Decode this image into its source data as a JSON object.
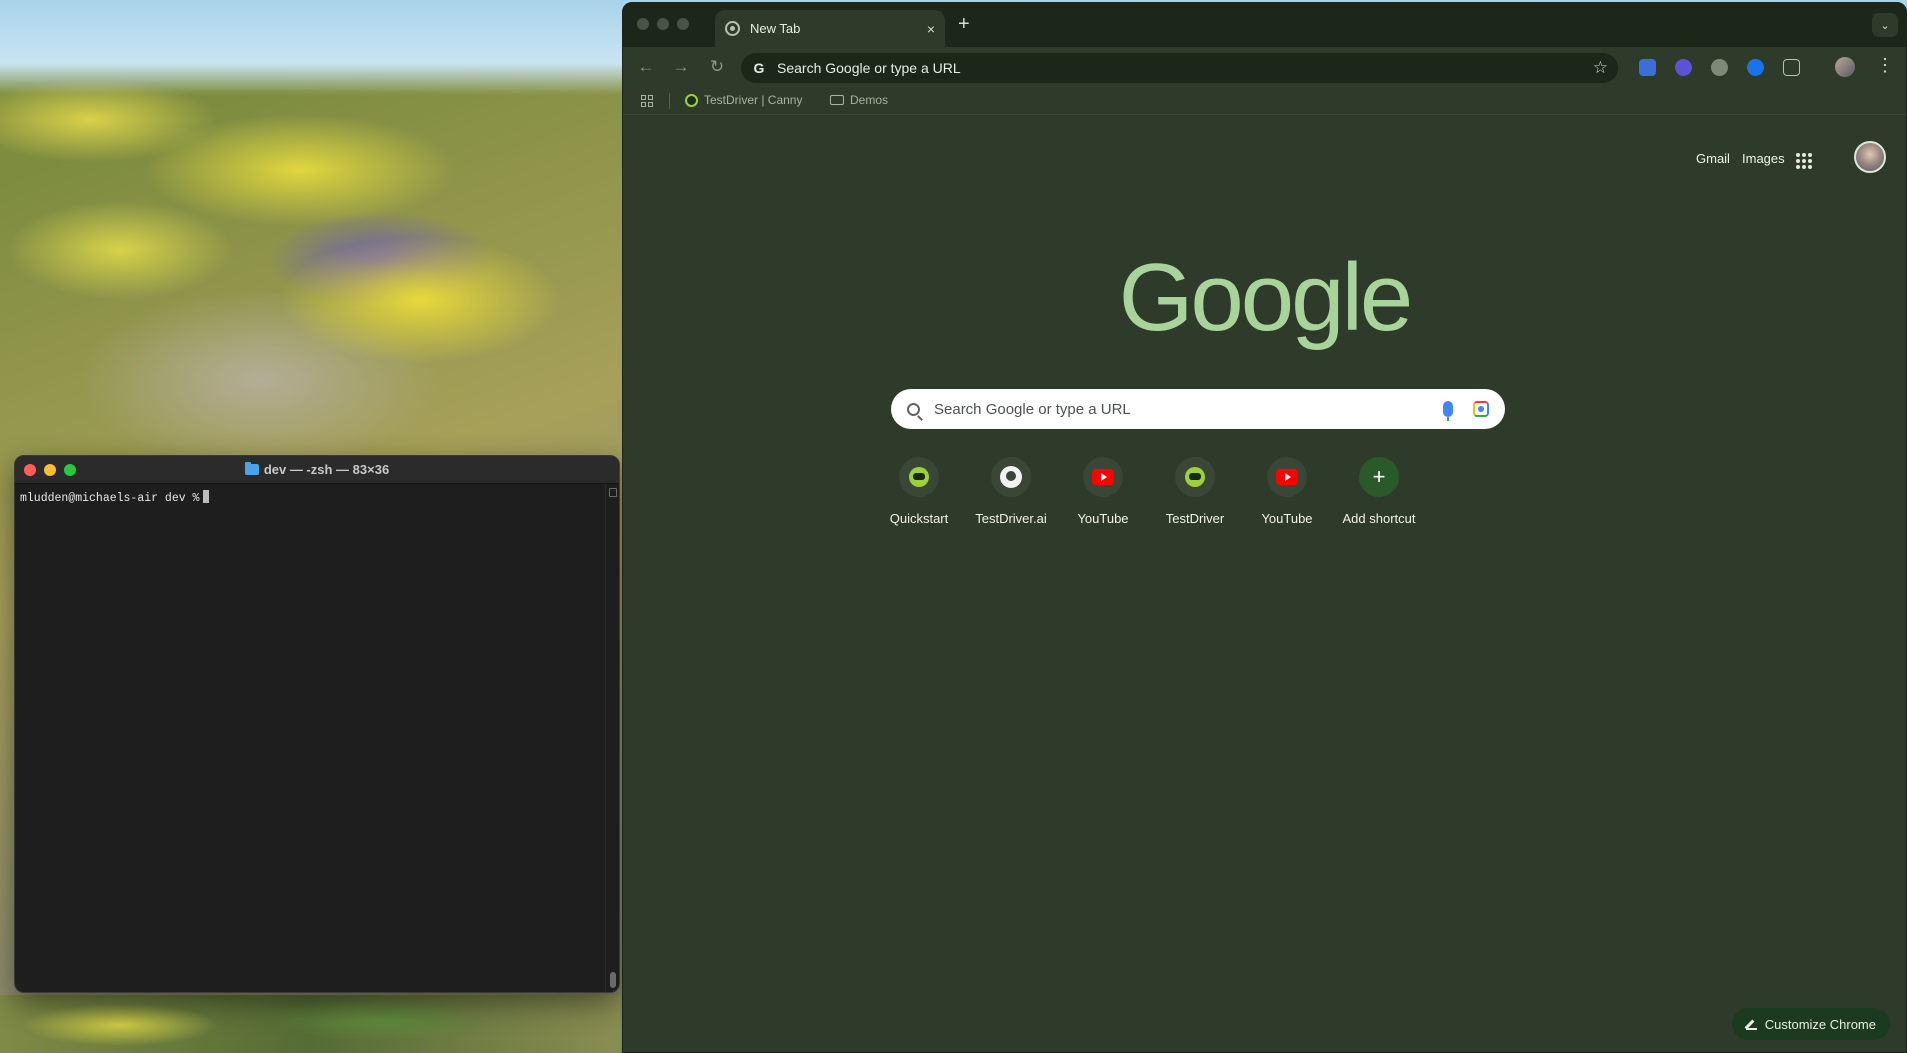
{
  "terminal": {
    "title": "dev — -zsh — 83×36",
    "prompt": "mludden@michaels-air dev %"
  },
  "chrome": {
    "tab": {
      "title": "New Tab",
      "close": "×"
    },
    "new_tab": "+",
    "tab_search": "⌄",
    "nav": {
      "back": "←",
      "forward": "→",
      "reload": "↻"
    },
    "omnibox": {
      "badge": "G",
      "text": "Search Google or type a URL",
      "star": "☆"
    },
    "kebab": "⋮",
    "bookmarks": [
      {
        "label": "TestDriver | Canny"
      },
      {
        "label": "Demos"
      }
    ]
  },
  "ntp": {
    "gmail": "Gmail",
    "images": "Images",
    "logo": "Google",
    "search_placeholder": "Search Google or type a URL",
    "shortcuts": [
      {
        "label": "Quickstart",
        "icon": "testdriver-icon"
      },
      {
        "label": "TestDriver.ai",
        "icon": "github-icon"
      },
      {
        "label": "YouTube",
        "icon": "youtube-icon"
      },
      {
        "label": "TestDriver",
        "icon": "testdriver-icon"
      },
      {
        "label": "YouTube",
        "icon": "youtube-icon"
      },
      {
        "label": "Add shortcut",
        "icon": "plus-icon"
      }
    ],
    "add_symbol": "+",
    "customize": "Customize Chrome"
  },
  "colors": {
    "chrome_bg": "#2e3b2a",
    "tabstrip_bg": "#1c2619",
    "google_logo": "#a8d39a",
    "terminal_bg": "#1e1e1e"
  }
}
